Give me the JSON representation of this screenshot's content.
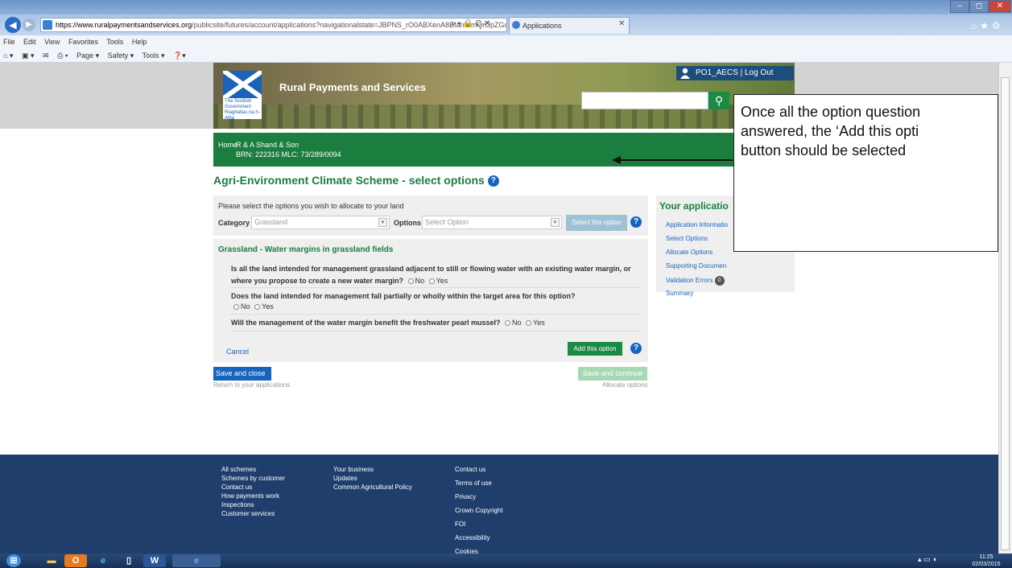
{
  "browser": {
    "url_host": "https://www.ruralpaymentsandservices.org",
    "url_path": "/publicsite/futures/account/applications?navigationalstate=JBPNS_rO0ABXenA8BfanNlmQnJpZGdlVml",
    "url_tools": "⌕ ▾ 🔒 C ✕",
    "tab_title": "Applications",
    "menu": [
      "File",
      "Edit",
      "View",
      "Favorites",
      "Tools",
      "Help"
    ],
    "commands": [
      "Page ▾",
      "Safety ▾",
      "Tools ▾"
    ]
  },
  "header": {
    "site_title": "Rural Payments and Services",
    "logo_text": "The Scottish Government Riaghaltas na h-Alba",
    "user": "PO1_AECS",
    "logout": "| Log Out"
  },
  "greenbar": {
    "home": "Home",
    "business": "R & A Shand & Son",
    "brn": "BRN: 222316 MLC: 73/289/0094"
  },
  "main": {
    "heading": "Agri-Environment Climate Scheme - select options",
    "select_intro": "Please select the options you wish to allocate to your land",
    "category_label": "Category",
    "category_value": "Grassland",
    "options_label": "Options",
    "options_placeholder": "Select Option",
    "select_btn": "Select this option",
    "option_title": "Grassland - Water margins in grassland fields",
    "q1a": "Is all the land intended for management grassland adjacent to still or flowing water with an existing water margin, or",
    "q1b": "where you propose to create a new water margin?",
    "q2a": "Does the land intended for management fall partially or wholly within the target area for this option?",
    "q3": "Will the management of the water margin benefit the freshwater pearl mussel?",
    "no": "No",
    "yes": "Yes",
    "cancel": "Cancel",
    "add_btn": "Add this option",
    "save_close": "Save and close",
    "save_close_sub": "Return to your applications",
    "save_continue": "Save and continue",
    "save_continue_sub": "Allocate options"
  },
  "sidebar": {
    "title": "Your applicatio",
    "items": [
      "Application Informatio",
      "Select Options",
      "Allocate Options",
      "Supporting Documen",
      "Validation Errors",
      "Summary"
    ],
    "validation_count": "0"
  },
  "callout": {
    "line1": "Once all the option question",
    "line2": "answered, the ‘Add this opti",
    "line3": "button should be selected"
  },
  "footer": {
    "col1": [
      "All schemes",
      "Schemes by customer",
      "Contact us",
      "How payments work",
      "Inspections",
      "Customer services"
    ],
    "col2": [
      "Your business",
      "Updates",
      "Common Agricultural Policy"
    ],
    "col3": [
      "Contact us",
      "Terms of use",
      "Privacy",
      "Crown Copyright",
      "FOI",
      "Accessibility",
      "Cookies"
    ]
  },
  "taskbar": {
    "time": "11:25",
    "date": "02/03/2015"
  }
}
